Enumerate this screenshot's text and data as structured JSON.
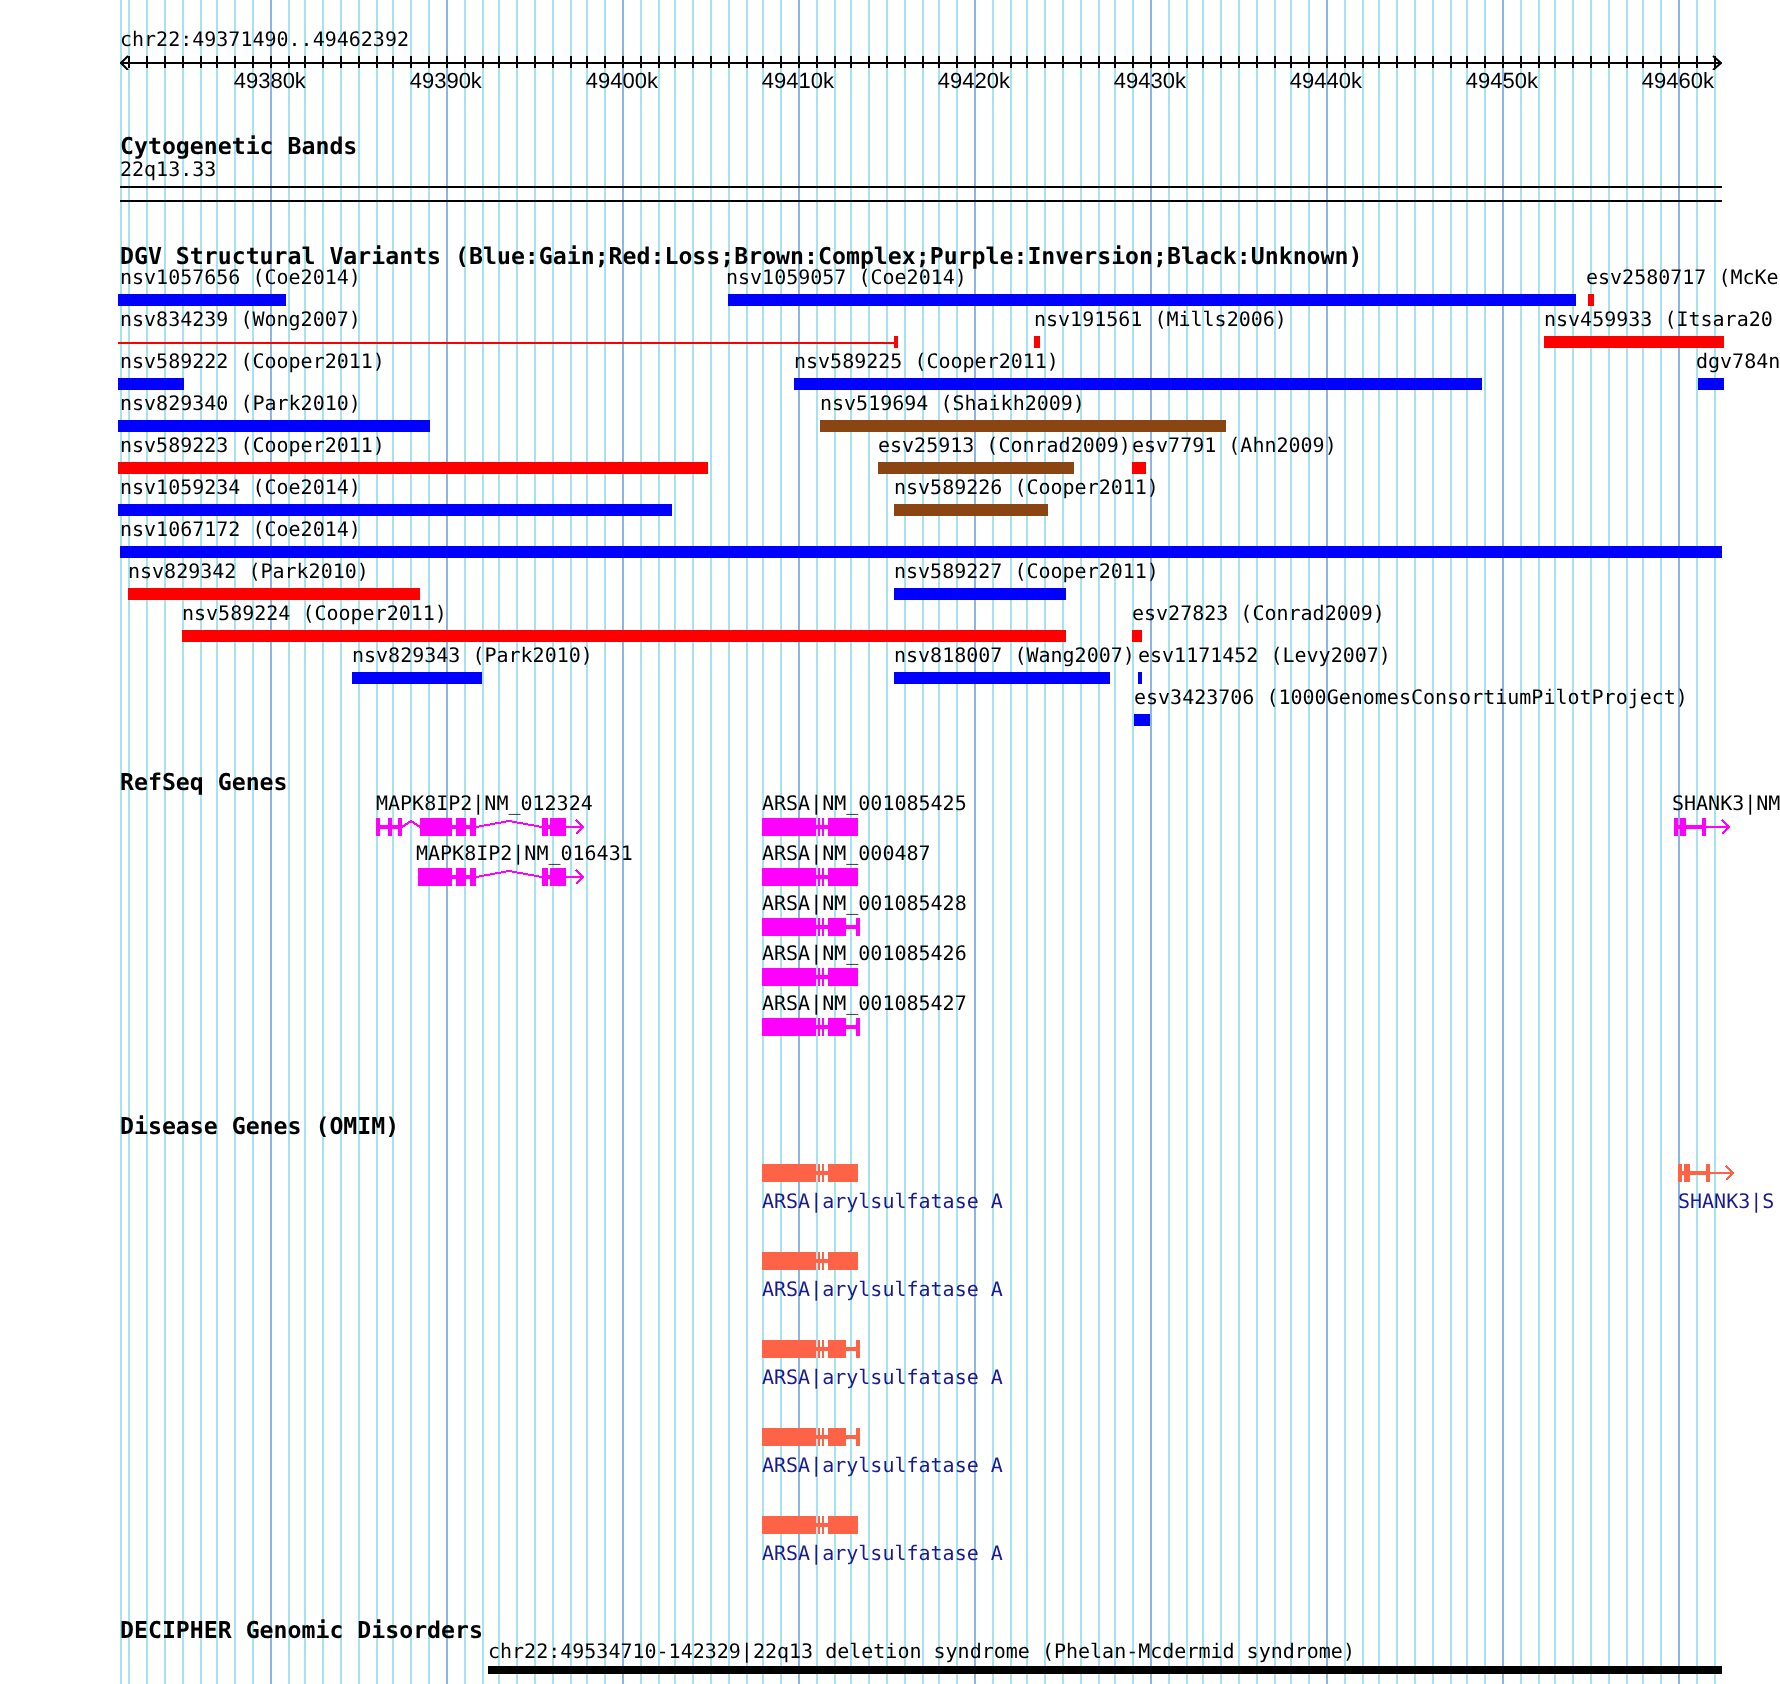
{
  "ruler": {
    "location": "chr22:49371490..49462392",
    "ticks": [
      "49380k",
      "49390k",
      "49400k",
      "49410k",
      "49420k",
      "49430k",
      "49440k",
      "49450k",
      "49460k"
    ]
  },
  "tracks": [
    {
      "kind": "cytoband",
      "title": "Cytogenetic Bands",
      "band": "22q13.33"
    },
    {
      "kind": "variants",
      "title": "DGV Structural Variants (Blue:Gain;Red:Loss;Brown:Complex;Purple:Inversion;Black:Unknown)",
      "features": [
        {
          "label": "nsv1057656 (Coe2014)",
          "kind": "bar",
          "color": "#0000ff"
        },
        {
          "label": "nsv1059057 (Coe2014)",
          "kind": "bar",
          "color": "#0000ff"
        },
        {
          "label": "esv2580717 (McKe",
          "kind": "bar",
          "color": "#ff0000"
        },
        {
          "label": "nsv834239 (Wong2007)",
          "kind": "line",
          "color": "#ff0000"
        },
        {
          "label": "nsv191561 (Mills2006)",
          "kind": "bar",
          "color": "#ff0000"
        },
        {
          "label": "nsv459933 (Itsara20",
          "kind": "bar",
          "color": "#ff0000"
        },
        {
          "label": "nsv589222 (Cooper2011)",
          "kind": "bar",
          "color": "#0000ff"
        },
        {
          "label": "nsv589225 (Cooper2011)",
          "kind": "bar",
          "color": "#0000ff"
        },
        {
          "label": "dgv784n",
          "kind": "bar",
          "color": "#0000ff"
        },
        {
          "label": "nsv829340 (Park2010)",
          "kind": "bar",
          "color": "#0000ff"
        },
        {
          "label": "nsv519694 (Shaikh2009)",
          "kind": "bar",
          "color": "#8b4513"
        },
        {
          "label": "nsv589223 (Cooper2011)",
          "kind": "bar",
          "color": "#ff0000"
        },
        {
          "label": "esv25913 (Conrad2009)",
          "kind": "bar",
          "color": "#8b4513"
        },
        {
          "label": "esv7791 (Ahn2009)",
          "kind": "bar",
          "color": "#ff0000"
        },
        {
          "label": "nsv1059234 (Coe2014)",
          "kind": "bar",
          "color": "#0000ff"
        },
        {
          "label": "nsv589226 (Cooper2011)",
          "kind": "bar",
          "color": "#8b4513"
        },
        {
          "label": "nsv1067172 (Coe2014)",
          "kind": "bar",
          "color": "#0000ff"
        },
        {
          "label": "nsv829342 (Park2010)",
          "kind": "bar",
          "color": "#ff0000"
        },
        {
          "label": "nsv589227 (Cooper2011)",
          "kind": "bar",
          "color": "#0000ff"
        },
        {
          "label": "nsv589224 (Cooper2011)",
          "kind": "bar",
          "color": "#ff0000"
        },
        {
          "label": "esv27823 (Conrad2009)",
          "kind": "bar",
          "color": "#ff0000"
        },
        {
          "label": "nsv829343 (Park2010)",
          "kind": "bar",
          "color": "#0000ff"
        },
        {
          "label": "nsv818007 (Wang2007)",
          "kind": "bar",
          "color": "#0000ff"
        },
        {
          "label": "esv1171452 (Levy2007)",
          "kind": "bar",
          "color": "#0000ff"
        },
        {
          "label": "esv3423706 (1000GenomesConsortiumPilotProject)",
          "kind": "bar",
          "color": "#0000ff"
        }
      ]
    },
    {
      "kind": "genes",
      "title": "RefSeq Genes",
      "features": [
        {
          "label": "MAPK8IP2|NM_012324"
        },
        {
          "label": "ARSA|NM_001085425"
        },
        {
          "label": "SHANK3|NM"
        },
        {
          "label": "MAPK8IP2|NM_016431"
        },
        {
          "label": "ARSA|NM_000487"
        },
        {
          "label": "ARSA|NM_001085428"
        },
        {
          "label": "ARSA|NM_001085426"
        },
        {
          "label": "ARSA|NM_001085427"
        }
      ]
    },
    {
      "kind": "disease",
      "title": "Disease Genes (OMIM)",
      "features": [
        {
          "label": "ARSA|arylsulfatase A"
        },
        {
          "label": "SHANK3|S"
        },
        {
          "label": "ARSA|arylsulfatase A"
        },
        {
          "label": "ARSA|arylsulfatase A"
        },
        {
          "label": "ARSA|arylsulfatase A"
        },
        {
          "label": "ARSA|arylsulfatase A"
        }
      ]
    },
    {
      "kind": "regions",
      "title": "DECIPHER Genomic Disorders",
      "features": [
        {
          "label": "chr22:49534710-142329|22q13 deletion syndrome (Phelan-Mcdermid syndrome)"
        }
      ]
    }
  ]
}
